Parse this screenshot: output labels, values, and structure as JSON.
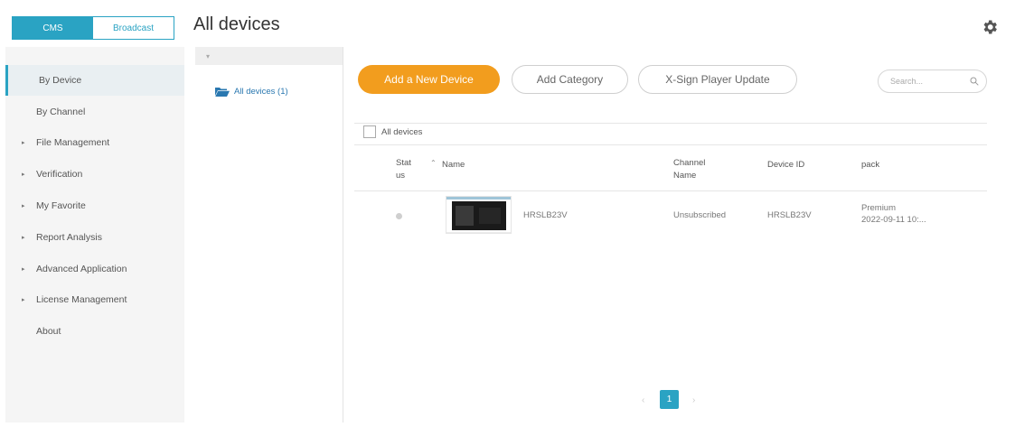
{
  "top_tabs": {
    "cms": "CMS",
    "broadcast": "Broadcast"
  },
  "page": {
    "title": "All devices"
  },
  "sidebar": {
    "items": [
      {
        "label": "By Device",
        "arrow": "",
        "active": true
      },
      {
        "label": "By Channel",
        "arrow": ""
      },
      {
        "label": "File Management",
        "arrow": "▸"
      },
      {
        "label": "Verification",
        "arrow": "▸"
      },
      {
        "label": "My Favorite",
        "arrow": "▸"
      },
      {
        "label": "Report Analysis",
        "arrow": "▸"
      },
      {
        "label": "Advanced Application",
        "arrow": "▸"
      },
      {
        "label": "License Management",
        "arrow": "▸"
      },
      {
        "label": "About",
        "arrow": ""
      }
    ]
  },
  "tree": {
    "collapse_glyph": "▾",
    "node_label": "All devices (1)"
  },
  "toolbar": {
    "add_device": "Add a New Device",
    "add_category": "Add Category",
    "player_update": "X-Sign Player Update",
    "search_placeholder": "Search..."
  },
  "table": {
    "select_all_label": "All devices",
    "headers": {
      "status": "Stat\nus",
      "sort_glyph": "⌃",
      "name": "Name",
      "channel_name": "Channel\nName",
      "device_id": "Device ID",
      "pack": "pack"
    },
    "rows": [
      {
        "name": "HRSLB23V",
        "channel_name": "Unsubscribed",
        "device_id": "HRSLB23V",
        "pack_line1": "Premium",
        "pack_line2": "2022-09-11 10:..."
      }
    ]
  },
  "pagination": {
    "prev": "‹",
    "current": "1",
    "next": "›"
  },
  "colors": {
    "accent": "#2aa3c3",
    "primary_button": "#f29d1e"
  }
}
